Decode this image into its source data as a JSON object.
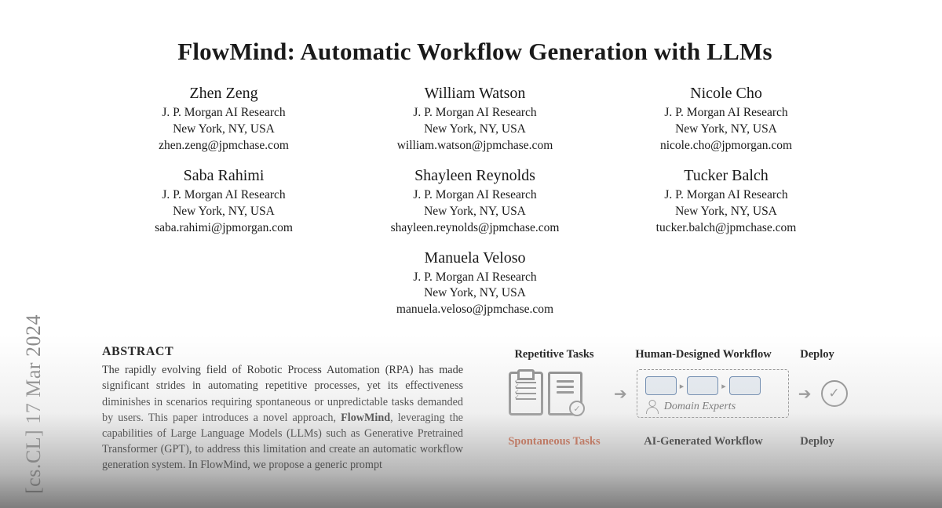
{
  "arxiv_sidebar": "[cs.CL]  17 Mar 2024",
  "title": "FlowMind: Automatic Workflow Generation with LLMs",
  "authors": [
    {
      "name": "Zhen Zeng",
      "affil": "J. P. Morgan AI Research",
      "loc": "New York, NY, USA",
      "email": "zhen.zeng@jpmchase.com"
    },
    {
      "name": "William Watson",
      "affil": "J. P. Morgan AI Research",
      "loc": "New York, NY, USA",
      "email": "william.watson@jpmchase.com"
    },
    {
      "name": "Nicole Cho",
      "affil": "J. P. Morgan AI Research",
      "loc": "New York, NY, USA",
      "email": "nicole.cho@jpmorgan.com"
    },
    {
      "name": "Saba Rahimi",
      "affil": "J. P. Morgan AI Research",
      "loc": "New York, NY, USA",
      "email": "saba.rahimi@jpmorgan.com"
    },
    {
      "name": "Shayleen Reynolds",
      "affil": "J. P. Morgan AI Research",
      "loc": "New York, NY, USA",
      "email": "shayleen.reynolds@jpmchase.com"
    },
    {
      "name": "Tucker Balch",
      "affil": "J. P. Morgan AI Research",
      "loc": "New York, NY, USA",
      "email": "tucker.balch@jpmchase.com"
    },
    {
      "name": "Manuela Veloso",
      "affil": "J. P. Morgan AI Research",
      "loc": "New York, NY, USA",
      "email": "manuela.veloso@jpmchase.com"
    }
  ],
  "abstract": {
    "heading": "ABSTRACT",
    "text_pre": "The rapidly evolving field of Robotic Process Automation (RPA) has made significant strides in automating repetitive processes, yet its effectiveness diminishes in scenarios requiring spontaneous or unpredictable tasks demanded by users. This paper introduces a novel approach, ",
    "bold": "FlowMind",
    "text_post": ", leveraging the capabilities of Large Language Models (LLMs) such as Generative Pretrained Transformer (GPT), to address this limitation and create an automatic workflow generation system. In FlowMind, we propose a generic prompt"
  },
  "figure": {
    "row1": {
      "c1": "Repetitive Tasks",
      "c2": "Human-Designed Workflow",
      "c3": "Deploy",
      "expert_label": "Domain Experts"
    },
    "row2": {
      "c1": "Spontaneous Tasks",
      "c2": "AI-Generated Workflow",
      "c3": "Deploy"
    }
  }
}
